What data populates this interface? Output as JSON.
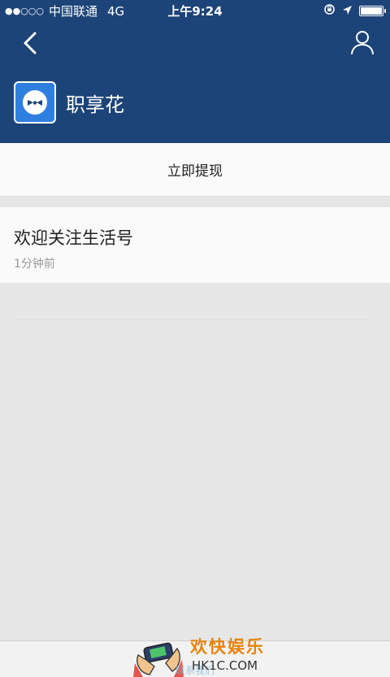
{
  "status_bar": {
    "signal": "●●○○○",
    "carrier": "中国联通",
    "network": "4G",
    "time": "上午9:24"
  },
  "nav": {
    "back_icon": "chevron-left-icon",
    "user_icon": "user-icon"
  },
  "account": {
    "name": "职享花",
    "logo_icon": "bowtie-face-logo"
  },
  "actions": {
    "withdraw_label": "立即提现"
  },
  "message": {
    "title": "欢迎关注生活号",
    "time": "1分钟前"
  },
  "watermark": {
    "title": "欢快娱乐",
    "domain": "HK1C.COM",
    "faint_text": "联系我们"
  },
  "colors": {
    "header_bg": "#1d4478",
    "logo_bg": "#2f7fe0",
    "watermark_accent": "#e6830f"
  }
}
